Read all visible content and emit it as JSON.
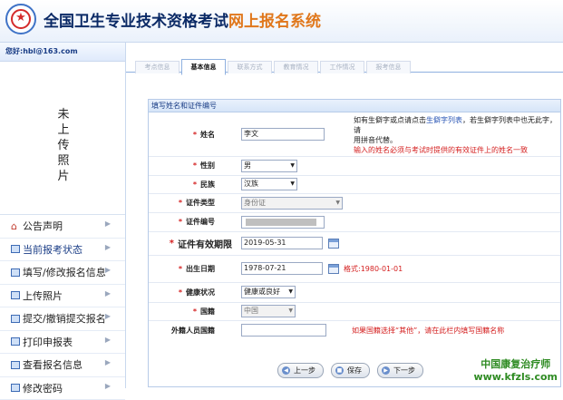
{
  "header": {
    "title_main": "全国卫生专业技术资格考试",
    "title_sub": "网上报名系统"
  },
  "sidebar": {
    "user": "您好:hbl@163.com",
    "photo_text": "未上传照片",
    "menu": [
      {
        "label": "公告声明",
        "icon": "home-icon"
      },
      {
        "label": "当前报考状态",
        "icon": "list-icon"
      },
      {
        "label": "填写/修改报名信息",
        "icon": "edit-icon"
      },
      {
        "label": "上传照片",
        "icon": "photo-icon"
      },
      {
        "label": "提交/撤销提交报名",
        "icon": "submit-icon"
      },
      {
        "label": "打印申报表",
        "icon": "print-icon"
      },
      {
        "label": "查看报名信息",
        "icon": "view-icon"
      },
      {
        "label": "修改密码",
        "icon": "key-icon"
      }
    ]
  },
  "tabs": [
    "考点信息",
    "基本信息",
    "联系方式",
    "教育情况",
    "工作情况",
    "报考信息"
  ],
  "active_tab": "基本信息",
  "form": {
    "section_title": "填写姓名和证件编号",
    "name_label": "姓名",
    "name_value": "李文",
    "name_hint_1a": "如有生僻字或点请点击",
    "name_hint_link": "生僻字列表",
    "name_hint_1b": "，若生僻字列表中也无此字，请",
    "name_hint_2": "用拼音代替。",
    "name_hint_3": "输入的姓名必须与考试时提供的有效证件上的姓名一致",
    "gender_label": "性别",
    "gender_value": "男",
    "ethnic_label": "民族",
    "ethnic_value": "汉族",
    "idtype_label": "证件类型",
    "idtype_value": "身份证",
    "idno_label": "证件编号",
    "expiry_label": "证件有效期限",
    "expiry_value": "2019-05-31",
    "birth_label": "出生日期",
    "birth_value": "1978-07-21",
    "birth_hint": "格式:1980-01-01",
    "health_label": "健康状况",
    "health_value": "健康或良好",
    "nation_label": "国籍",
    "nation_value": "中国",
    "foreign_label": "外籍人员国籍",
    "foreign_value": "",
    "foreign_hint": "如果国籍选择“其他”，请在此栏内填写国籍名称"
  },
  "buttons": {
    "prev": "上一步",
    "save": "保存",
    "next": "下一步"
  },
  "watermark": {
    "line1": "中国康复治疗师",
    "line2": "www.kfzls.com"
  }
}
